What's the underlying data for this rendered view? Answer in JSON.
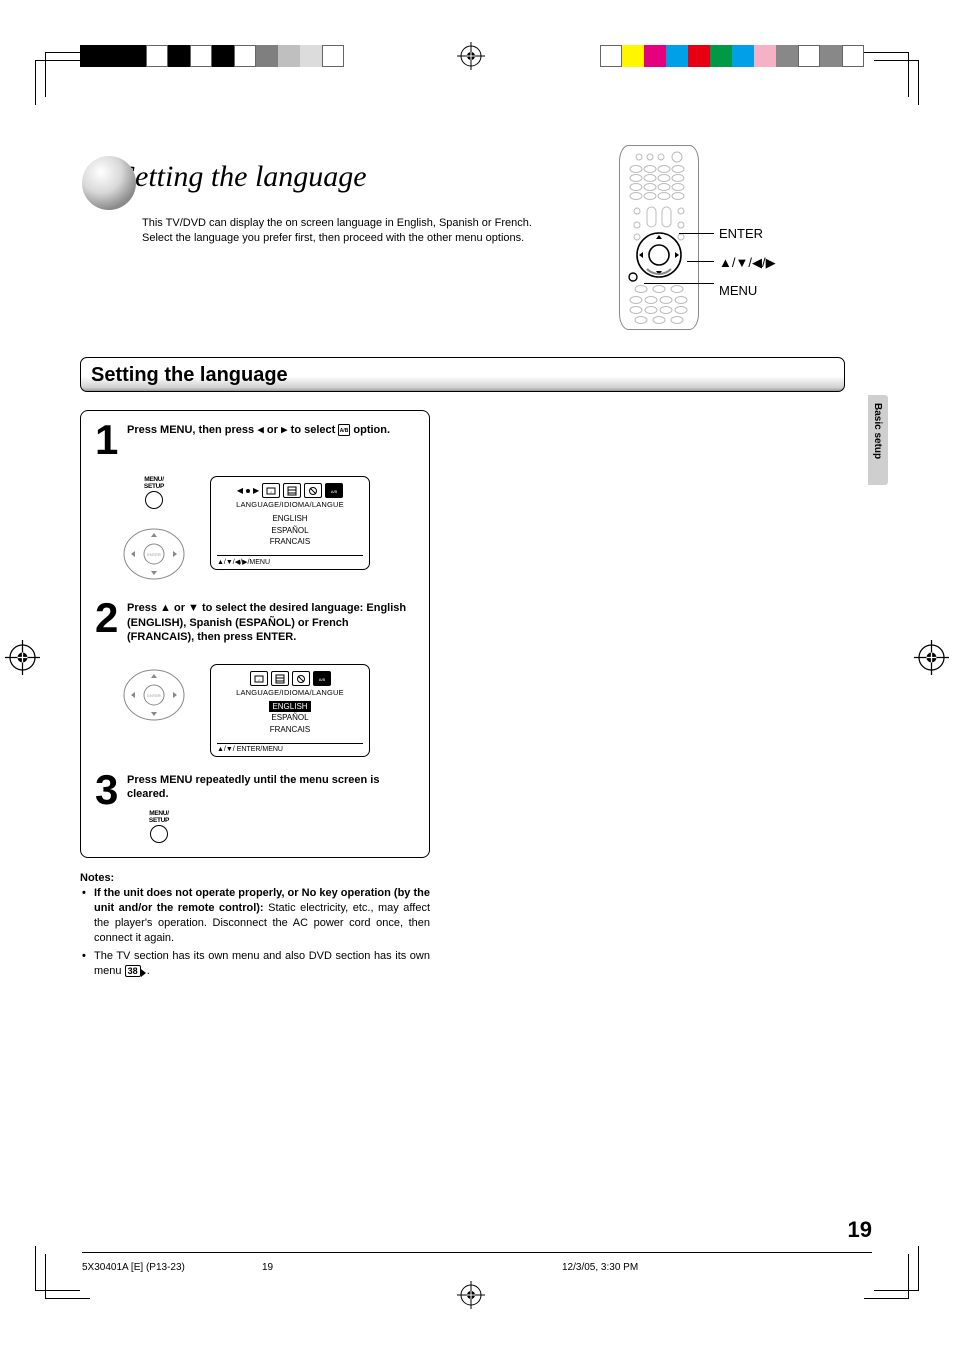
{
  "title": "Setting the language",
  "intro": "This TV/DVD can display the on screen language in English, Spanish or French. Select the language you prefer first, then proceed with the other menu options.",
  "remote": {
    "label_enter": "ENTER",
    "label_arrows": "▲/▼/◀/▶",
    "label_menu": "MENU"
  },
  "heading": "Setting the language",
  "side_tab": "Basic setup",
  "steps": [
    {
      "num": "1",
      "text_pre": "Press MENU, then press ",
      "arrow_l": "◀",
      "text_mid": " or ",
      "arrow_r": "▶",
      "text_post": " to select ",
      "text_end": " option.",
      "menu_btn_label": "MENU/\nSETUP",
      "osd": {
        "title": "LANGUAGE/IDIOMA/LANGUE",
        "options": [
          "ENGLISH",
          "ESPAÑOL",
          "FRANCAIS"
        ],
        "selected_index": -1,
        "hint": "▲/▼/◀/▶/MENU",
        "nav_prefix": "◀▶"
      }
    },
    {
      "num": "2",
      "text": "Press ▲ or ▼ to select the desired language: English (ENGLISH), Spanish (ESPAÑOL) or French (FRANCAIS), then press ENTER.",
      "osd": {
        "title": "LANGUAGE/IDIOMA/LANGUE",
        "options": [
          "ENGLISH",
          "ESPAÑOL",
          "FRANCAIS"
        ],
        "selected_index": 0,
        "hint": "▲/▼/ ENTER/MENU"
      }
    },
    {
      "num": "3",
      "text": "Press MENU repeatedly until the menu screen is cleared.",
      "menu_btn_label": "MENU/\nSETUP"
    }
  ],
  "notes_label": "Notes:",
  "notes": [
    {
      "bold": "If the unit does not operate properly, or No key operation (by the unit and/or the remote control):",
      "rest": " Static electricity, etc., may affect the player's operation. Disconnect the AC power cord once, then connect it again."
    },
    {
      "bold": "",
      "rest": "The TV section has its own menu and also DVD section has its own menu ",
      "pageref": "38",
      "tail": "."
    }
  ],
  "page_number": "19",
  "footer": {
    "doc": "5X30401A [E] (P13-23)",
    "pg": "19",
    "dt": "12/3/05, 3:30 PM"
  },
  "colors": {
    "strip_left": [
      "#000",
      "#000",
      "#000",
      "#fff",
      "#000",
      "#fff",
      "#000",
      "#fff",
      "#7f7f7f",
      "#bfbfbf",
      "#dcdcdc",
      "#fff"
    ],
    "strip_right": [
      "#fff",
      "#fff600",
      "#e4007f",
      "#00a0e9",
      "#e60012",
      "#009944",
      "#009fe8",
      "#f5b2c6",
      "#888",
      "#fff",
      "#888",
      "#fff"
    ]
  }
}
